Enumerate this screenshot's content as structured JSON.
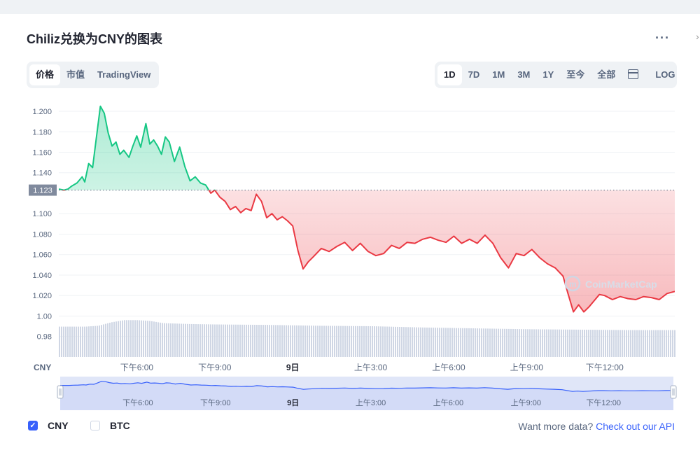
{
  "header": {
    "title": "Chiliz兑换为CNY的图表",
    "more_icon": "more-horizontal-icon"
  },
  "view_tabs": [
    {
      "label": "价格",
      "active": true
    },
    {
      "label": "市值",
      "active": false
    },
    {
      "label": "TradingView",
      "active": false
    }
  ],
  "range_tabs": [
    {
      "label": "1D",
      "active": true
    },
    {
      "label": "7D",
      "active": false
    },
    {
      "label": "1M",
      "active": false
    },
    {
      "label": "3M",
      "active": false
    },
    {
      "label": "1Y",
      "active": false
    },
    {
      "label": "至今",
      "active": false
    },
    {
      "label": "全部",
      "active": false
    }
  ],
  "calendar_icon": "calendar-icon",
  "log_label": "LOG",
  "watermark": "CoinMarketCap",
  "chart_data": {
    "type": "area",
    "currency_label": "CNY",
    "y_ticks": [
      1.2,
      1.18,
      1.16,
      1.14,
      1.1,
      1.08,
      1.06,
      1.04,
      1.02,
      1.0,
      0.98
    ],
    "y_tick_labels": [
      "1.200",
      "1.180",
      "1.160",
      "1.140",
      "1.100",
      "1.080",
      "1.060",
      "1.040",
      "1.020",
      "1.00",
      "0.98"
    ],
    "ylim": [
      0.962,
      1.213
    ],
    "reference_value": 1.123,
    "reference_label": "1.123",
    "x_ticks": [
      {
        "t": 3.0,
        "label": "下午6:00",
        "bold": false
      },
      {
        "t": 6.0,
        "label": "下午9:00",
        "bold": false
      },
      {
        "t": 9.0,
        "label": "9日",
        "bold": true
      },
      {
        "t": 12.0,
        "label": "上午3:00",
        "bold": false
      },
      {
        "t": 15.0,
        "label": "上午6:00",
        "bold": false
      },
      {
        "t": 18.0,
        "label": "上午9:00",
        "bold": false
      },
      {
        "t": 21.0,
        "label": "下午12:00",
        "bold": false
      }
    ],
    "xlim": [
      0,
      23.7
    ],
    "price_series": {
      "name": "CNY",
      "t": [
        0.0,
        0.2,
        0.35,
        0.5,
        0.7,
        0.9,
        1.0,
        1.15,
        1.3,
        1.45,
        1.6,
        1.75,
        1.9,
        2.05,
        2.2,
        2.35,
        2.5,
        2.7,
        2.85,
        3.0,
        3.15,
        3.35,
        3.5,
        3.65,
        3.8,
        3.95,
        4.1,
        4.25,
        4.45,
        4.65,
        4.85,
        5.05,
        5.25,
        5.45,
        5.65,
        5.85,
        6.0,
        6.2,
        6.4,
        6.6,
        6.8,
        7.0,
        7.2,
        7.4,
        7.6,
        7.8,
        8.0,
        8.2,
        8.4,
        8.6,
        8.8,
        9.0,
        9.2,
        9.4,
        9.6,
        9.8,
        10.1,
        10.4,
        10.7,
        11.0,
        11.3,
        11.6,
        11.9,
        12.2,
        12.5,
        12.8,
        13.1,
        13.4,
        13.7,
        14.0,
        14.3,
        14.6,
        14.9,
        15.2,
        15.5,
        15.8,
        16.1,
        16.4,
        16.7,
        17.0,
        17.3,
        17.6,
        17.9,
        18.2,
        18.5,
        18.8,
        19.1,
        19.4,
        19.6,
        19.8,
        20.0,
        20.2,
        20.4,
        20.6,
        20.8,
        21.0,
        21.3,
        21.6,
        21.9,
        22.2,
        22.5,
        22.8,
        23.1,
        23.4,
        23.7
      ],
      "values": [
        1.124,
        1.123,
        1.124,
        1.127,
        1.13,
        1.136,
        1.131,
        1.149,
        1.145,
        1.175,
        1.205,
        1.198,
        1.179,
        1.166,
        1.17,
        1.158,
        1.162,
        1.155,
        1.166,
        1.176,
        1.165,
        1.188,
        1.168,
        1.172,
        1.166,
        1.158,
        1.175,
        1.17,
        1.151,
        1.165,
        1.146,
        1.132,
        1.136,
        1.13,
        1.128,
        1.12,
        1.123,
        1.116,
        1.112,
        1.104,
        1.107,
        1.101,
        1.105,
        1.103,
        1.119,
        1.112,
        1.096,
        1.1,
        1.094,
        1.097,
        1.093,
        1.088,
        1.064,
        1.046,
        1.053,
        1.058,
        1.066,
        1.063,
        1.068,
        1.072,
        1.064,
        1.071,
        1.063,
        1.059,
        1.061,
        1.069,
        1.066,
        1.072,
        1.071,
        1.075,
        1.077,
        1.074,
        1.072,
        1.078,
        1.071,
        1.075,
        1.071,
        1.079,
        1.071,
        1.057,
        1.047,
        1.061,
        1.059,
        1.065,
        1.057,
        1.051,
        1.047,
        1.039,
        1.021,
        1.004,
        1.011,
        1.004,
        1.009,
        1.015,
        1.021,
        1.02,
        1.016,
        1.019,
        1.017,
        1.016,
        1.019,
        1.018,
        1.016,
        1.022,
        1.024
      ]
    },
    "volume_series": {
      "t": [
        0,
        1,
        1.5,
        2,
        2.5,
        3,
        3.5,
        4,
        5,
        6,
        8,
        10,
        12,
        14,
        16,
        18,
        20,
        22,
        23.7
      ],
      "values": [
        0.7,
        0.7,
        0.72,
        0.8,
        0.85,
        0.85,
        0.83,
        0.78,
        0.76,
        0.75,
        0.74,
        0.72,
        0.71,
        0.68,
        0.66,
        0.64,
        0.63,
        0.62,
        0.62
      ]
    },
    "navigator_x_ticks": [
      {
        "t": 3.0,
        "label": "下午6:00",
        "bold": false
      },
      {
        "t": 6.0,
        "label": "下午9:00",
        "bold": false
      },
      {
        "t": 9.0,
        "label": "9日",
        "bold": true
      },
      {
        "t": 12.0,
        "label": "上午3:00",
        "bold": false
      },
      {
        "t": 15.0,
        "label": "上午6:00",
        "bold": false
      },
      {
        "t": 18.0,
        "label": "上午9:00",
        "bold": false
      },
      {
        "t": 21.0,
        "label": "下午12:00",
        "bold": false
      }
    ],
    "colors": {
      "up": "#16c784",
      "down": "#ea3943",
      "grid": "#eff2f5",
      "volume": "#cfd6e4",
      "navigator": "#3861fb"
    }
  },
  "legend": [
    {
      "label": "CNY",
      "checked": true
    },
    {
      "label": "BTC",
      "checked": false
    }
  ],
  "footer": {
    "prompt": "Want more data? ",
    "link": "Check out our API"
  }
}
